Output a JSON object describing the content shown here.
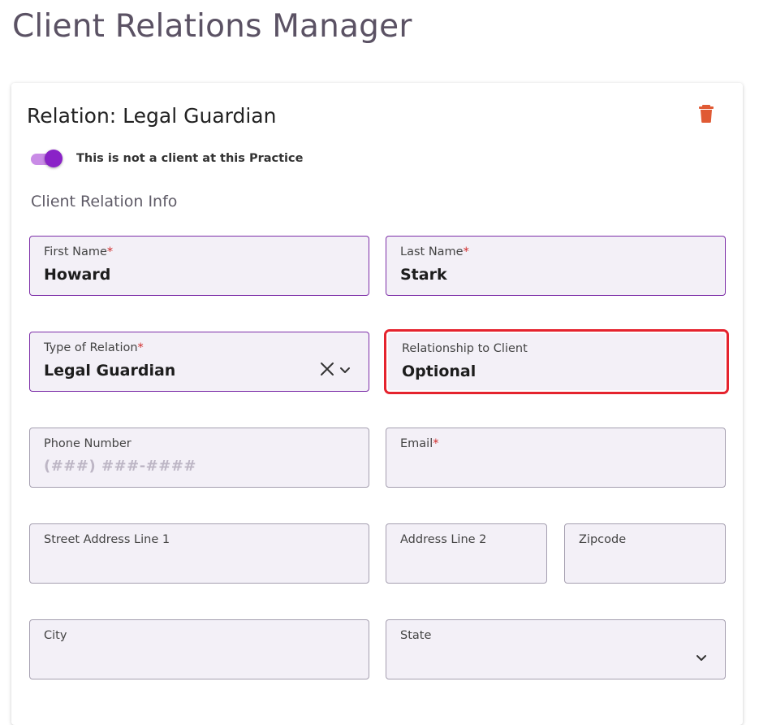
{
  "page": {
    "title": "Client Relations Manager"
  },
  "card": {
    "title": "Relation: Legal Guardian",
    "delete_icon": "trash-icon",
    "toggle": {
      "label": "This is not a client at this Practice",
      "on": true
    },
    "section_title": "Client Relation Info"
  },
  "fields": {
    "first_name": {
      "label": "First Name",
      "required": "*",
      "value": "Howard"
    },
    "last_name": {
      "label": "Last Name",
      "required": "*",
      "value": "Stark"
    },
    "type_of_relation": {
      "label": "Type of Relation",
      "required": "*",
      "value": "Legal Guardian",
      "clear_icon": "close-icon",
      "dropdown_icon": "chevron-down-icon"
    },
    "relationship_to_client": {
      "label": "Relationship to Client",
      "value": "Optional"
    },
    "phone": {
      "label": "Phone Number",
      "placeholder": "(###) ###-####"
    },
    "email": {
      "label": "Email",
      "required": "*"
    },
    "street1": {
      "label": "Street Address Line 1"
    },
    "address2": {
      "label": "Address Line 2"
    },
    "zipcode": {
      "label": "Zipcode"
    },
    "city": {
      "label": "City"
    },
    "state": {
      "label": "State",
      "dropdown_icon": "chevron-down-icon"
    }
  },
  "colors": {
    "accent": "#8a22c7",
    "delete": "#e05a34",
    "highlight": "#e5232e",
    "field_bg": "#f3f0f7"
  }
}
